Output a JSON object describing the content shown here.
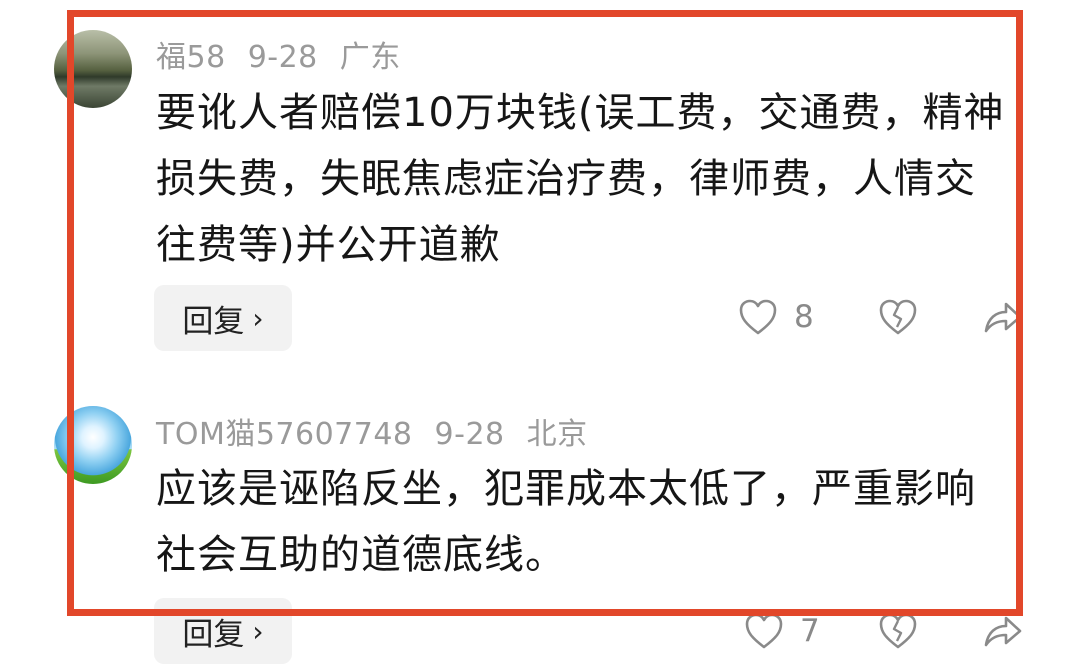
{
  "comments": [
    {
      "user": "福58",
      "date": "9-28",
      "location": "广东",
      "text": "要讹人者赔偿10万块钱(误工费，交通费，精神损失费，失眠焦虑症治疗费，律师费，人情交往费等)并公开道歉",
      "reply_label": "回复",
      "like_count": "8"
    },
    {
      "user": "TOM猫57607748",
      "date": "9-28",
      "location": "北京",
      "text": "应该是诬陷反坐，犯罪成本太低了，严重影响社会互助的道德底线。",
      "reply_label": "回复",
      "like_count": "7"
    }
  ],
  "icons": {
    "like": "heart-icon",
    "dislike": "broken-heart-icon",
    "share": "share-arrow-icon"
  },
  "colors": {
    "highlight_border": "#e2472a",
    "meta_text": "#9a9a9a",
    "body_text": "#161616",
    "reply_bg": "#f2f2f2"
  }
}
